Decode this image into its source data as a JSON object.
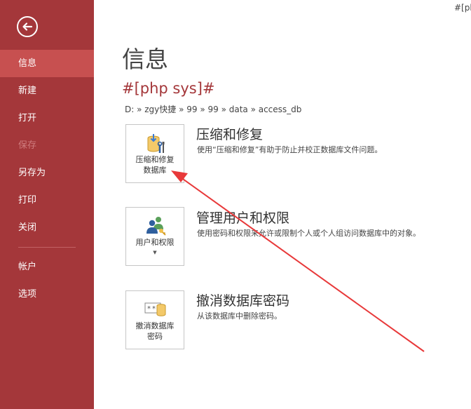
{
  "sidebar": {
    "items": [
      {
        "label": "信息",
        "state": "active"
      },
      {
        "label": "新建",
        "state": "normal"
      },
      {
        "label": "打开",
        "state": "normal"
      },
      {
        "label": "保存",
        "state": "disabled"
      },
      {
        "label": "另存为",
        "state": "normal"
      },
      {
        "label": "打印",
        "state": "normal"
      },
      {
        "label": "关闭",
        "state": "normal"
      }
    ],
    "items_bottom": [
      {
        "label": "帐户"
      },
      {
        "label": "选项"
      }
    ]
  },
  "top_right_text": "#[pl",
  "main": {
    "title": "信息",
    "db_name": "#[php sys]#",
    "path": "D: » zgy快捷 » 99 » 99 » data » access_db",
    "sections": [
      {
        "tile_line1": "压缩和修复",
        "tile_line2": "数据库",
        "title": "压缩和修复",
        "desc": "使用“压缩和修复”有助于防止并校正数据库文件问题。"
      },
      {
        "tile_line1": "用户和权限",
        "title": "管理用户和权限",
        "desc": "使用密码和权限来允许或限制个人或个人组访问数据库中的对象。"
      },
      {
        "tile_line1": "撤消数据库",
        "tile_line2": "密码",
        "title": "撤消数据库密码",
        "desc": "从该数据库中删除密码。"
      }
    ]
  },
  "colors": {
    "sidebar_bg": "#a4373a",
    "sidebar_active": "#c75050",
    "accent_red": "#a4373a",
    "annotation_arrow": "#e8393a"
  }
}
